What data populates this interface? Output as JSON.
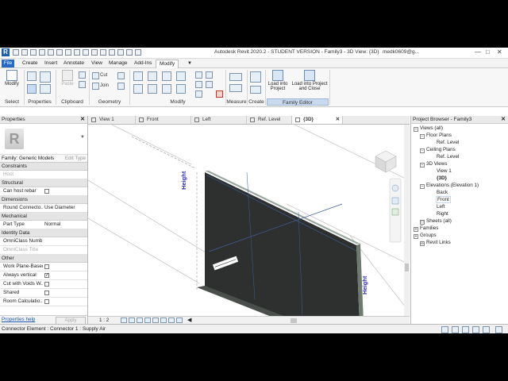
{
  "app": {
    "logo": "R",
    "title": "Autodesk Revit 2020.2 - STUDENT VERSION - Family3 - 3D View: {3D}",
    "user": "medk0609@g..."
  },
  "tabs": [
    "File",
    "Create",
    "Insert",
    "Annotate",
    "View",
    "Manage",
    "Add-Ins",
    "Modify"
  ],
  "active_tab": "Modify",
  "ribbon": {
    "modify_label": "Modify",
    "select_label": "Select",
    "properties_label": "Properties",
    "clipboard_label": "Clipboard",
    "paste_label": "Paste",
    "cut_label": "Cut",
    "join_label": "Join",
    "geometry_label": "Geometry",
    "modify_group": "Modify",
    "measure_group": "Measure",
    "create_group": "Create",
    "family_editor_group": "Family Editor",
    "load_into_project": "Load into Project",
    "load_into_project_close": "Load into Project and Close"
  },
  "properties": {
    "header": "Properties",
    "family": "Family: Generic Models",
    "edit_type": "Edit Type",
    "sections": {
      "constraints": "Constraints",
      "structural": "Structural",
      "dimensions": "Dimensions",
      "mechanical": "Mechanical",
      "identity": "Identity Data",
      "other": "Other"
    },
    "rows": {
      "host": "Host",
      "can_host_rebar": "Can host rebar",
      "round_connector": "Round Connecto...",
      "round_connector_val": "Use Diameter",
      "part_type": "Part Type",
      "part_type_val": "Normal",
      "omniclass_number": "OmniClass Numb...",
      "omniclass_title": "OmniClass Title",
      "work_plane_based": "Work Plane-Based",
      "always_vertical": "Always vertical",
      "cut_with_voids": "Cut with Voids W...",
      "shared": "Shared",
      "room_calculation": "Room Calculatio..."
    },
    "help": "Properties help",
    "apply": "Apply"
  },
  "view_tabs": [
    "View 1",
    "Front",
    "Left",
    "Ref. Level",
    "{3D}"
  ],
  "active_view_tab": "{3D}",
  "canvas": {
    "height_label_1": "Height",
    "height_label_2": "Height"
  },
  "view_bar": {
    "scale": "1 : 2"
  },
  "project_browser": {
    "header": "Project Browser - Family3",
    "views_all": "Views (all)",
    "floor_plans": "Floor Plans",
    "ref_level_1": "Ref. Level",
    "ceiling_plans": "Ceiling Plans",
    "ref_level_2": "Ref. Level",
    "views_3d": "3D Views",
    "view1": "View 1",
    "view_3d": "{3D}",
    "elevations": "Elevations (Elevation 1)",
    "back": "Back",
    "front": "Front",
    "left": "Left",
    "right": "Right",
    "sheets": "Sheets (all)",
    "families": "Families",
    "groups": "Groups",
    "revit_links": "Revit Links"
  },
  "status": {
    "message": "Connector Element : Connector 1 : Supply Air"
  }
}
